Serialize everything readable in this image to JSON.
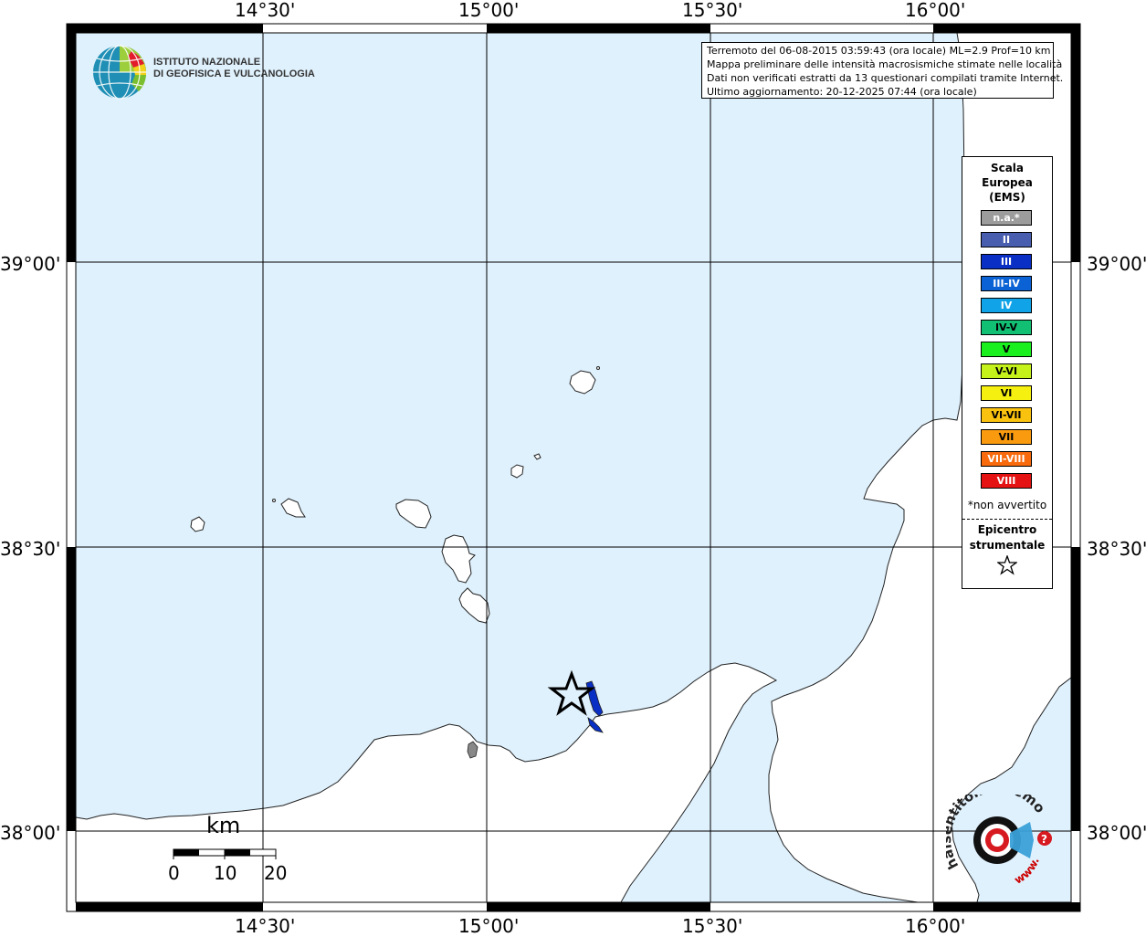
{
  "map": {
    "lon_labels": [
      "14°30'",
      "15°00'",
      "15°30'",
      "16°00'"
    ],
    "lat_labels": [
      "39°00'",
      "38°30'",
      "38°00'"
    ],
    "colors": {
      "sea": "#dff1fd",
      "land": "#ffffff",
      "grid": "#000000",
      "coast": "#222222"
    }
  },
  "logo": {
    "line1": "ISTITUTO NAZIONALE",
    "line2": "DI GEOFISICA E VULCANOLOGIA"
  },
  "info": {
    "line1": "Terremoto del 06-08-2015 03:59:43 (ora locale) ML=2.9 Prof=10 km",
    "line2": "Mappa preliminare delle intensità macrosismiche stimate nelle località",
    "line3": "Dati non verificati estratti da 13 questionari compilati tramite Internet.",
    "line4": "Ultimo aggiornamento: 20-12-2025 07:44 (ora locale)"
  },
  "legend": {
    "title1": "Scala",
    "title2": "Europea",
    "title3": "(EMS)",
    "items": [
      {
        "label": "n.a.*",
        "color": "#9c9c9c"
      },
      {
        "label": "II",
        "color": "#4a5eb0"
      },
      {
        "label": "III",
        "color": "#0a2fc4"
      },
      {
        "label": "III-IV",
        "color": "#0b62d4"
      },
      {
        "label": "IV",
        "color": "#10a3e8"
      },
      {
        "label": "IV-V",
        "color": "#12c074"
      },
      {
        "label": "V",
        "color": "#19f01e"
      },
      {
        "label": "V-VI",
        "color": "#c4f21a"
      },
      {
        "label": "VI",
        "color": "#f5f00f"
      },
      {
        "label": "VI-VII",
        "color": "#f9c20f"
      },
      {
        "label": "VII",
        "color": "#f99a0f"
      },
      {
        "label": "VII-VIII",
        "color": "#f86a0c"
      },
      {
        "label": "VIII",
        "color": "#e41212"
      }
    ],
    "note": "*non avvertito",
    "epicentre1": "Epicentro",
    "epicentre2": "strumentale"
  },
  "scale": {
    "unit": "km",
    "ticks": [
      "0",
      "10",
      "20"
    ]
  },
  "watermark": {
    "text1": "haisentitoilterremoto.it",
    "text2": "www."
  }
}
